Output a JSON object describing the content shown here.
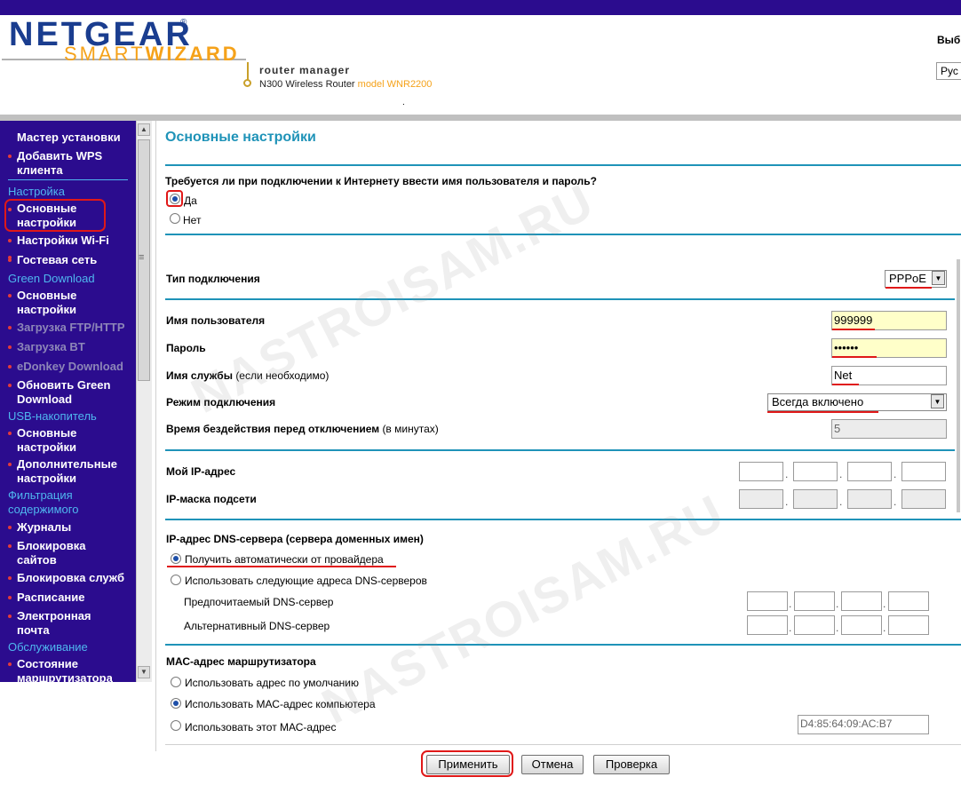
{
  "header": {
    "brand": "NETGEAR",
    "brand_reg": "®",
    "smart": "SMART",
    "wizard": "WIZARD",
    "router_manager": "router manager",
    "model_line": "N300 Wireless Router",
    "model_name": "model WNR2200",
    "lang_label": "Выб",
    "lang_select": "Рус",
    "dot": "."
  },
  "sidebar": {
    "items": [
      {
        "label_1": "Мастер установки"
      },
      {
        "label_1": "Добавить WPS",
        "label_2": "клиента"
      },
      {
        "head": "Настройка"
      },
      {
        "label_1": "Основные",
        "label_2": "настройки"
      },
      {
        "label_1": "Настройки Wi-Fi"
      },
      {
        "label_1": "Гостевая сеть"
      },
      {
        "head": "Green Download"
      },
      {
        "label_1": "Основные",
        "label_2": "настройки"
      },
      {
        "label_1": "Загрузка FTP/HTTP"
      },
      {
        "label_1": "Загрузка BT"
      },
      {
        "label_1": "eDonkey Download"
      },
      {
        "label_1": "Обновить Green",
        "label_2": "Download"
      },
      {
        "head": "USB-накопитель"
      },
      {
        "label_1": "Основные",
        "label_2": "настройки"
      },
      {
        "label_1": "Дополнительные",
        "label_2": "настройки"
      },
      {
        "head_1": "Фильтрация",
        "head_2": "содержимого"
      },
      {
        "label_1": "Журналы"
      },
      {
        "label_1": "Блокировка",
        "label_2": "сайтов"
      },
      {
        "label_1": "Блокировка служб"
      },
      {
        "label_1": "Расписание"
      },
      {
        "label_1": "Электронная",
        "label_2": "почта"
      },
      {
        "head": "Обслуживание"
      },
      {
        "label_1": "Состояние",
        "label_2": "маршрутизатора"
      }
    ]
  },
  "main": {
    "title": "Основные настройки",
    "login_question": "Требуется ли при подключении к Интернету ввести имя пользователя и пароль?",
    "yes": "Да",
    "no": "Нет",
    "conn_type_label": "Тип подключения",
    "conn_type_value": "PPPoE",
    "username_label": "Имя пользователя",
    "username_value": "999999",
    "password_label": "Пароль",
    "password_value": "••••••",
    "service_label": "Имя службы",
    "service_note": "(если необходимо)",
    "service_value": "Net",
    "mode_label": "Режим подключения",
    "mode_value": "Всегда включено",
    "idle_label": "Время бездействия перед отключением",
    "idle_note": "(в минутах)",
    "idle_value": "5",
    "my_ip_label": "Мой IP-адрес",
    "mask_label": "IP-маска подсети",
    "dns_title": "IP-адрес DNS-сервера (сервера доменных имен)",
    "dns_auto": "Получить автоматически от провайдера",
    "dns_manual": "Использовать следующие адреса DNS-серверов",
    "dns_primary": "Предпочитаемый DNS-сервер",
    "dns_alt": "Альтернативный DNS-сервер",
    "mac_title": "МАС-адрес маршрутизатора",
    "mac_default": "Использовать адрес по умолчанию",
    "mac_computer": "Использовать МАС-адрес компьютера",
    "mac_this": "Использовать этот МАС-адрес",
    "mac_value": "D4:85:64:09:AC:B7",
    "apply": "Применить",
    "cancel": "Отмена",
    "test": "Проверка",
    "ip_dot": "."
  },
  "watermark": "NASTROISAM.RU",
  "colors": {
    "sidebar_bg": "#2b0c8e",
    "heading_blue": "#1f93b8",
    "highlight_red": "#e01818",
    "brand_blue": "#1a3d8f",
    "brand_orange": "#f5a21a"
  }
}
